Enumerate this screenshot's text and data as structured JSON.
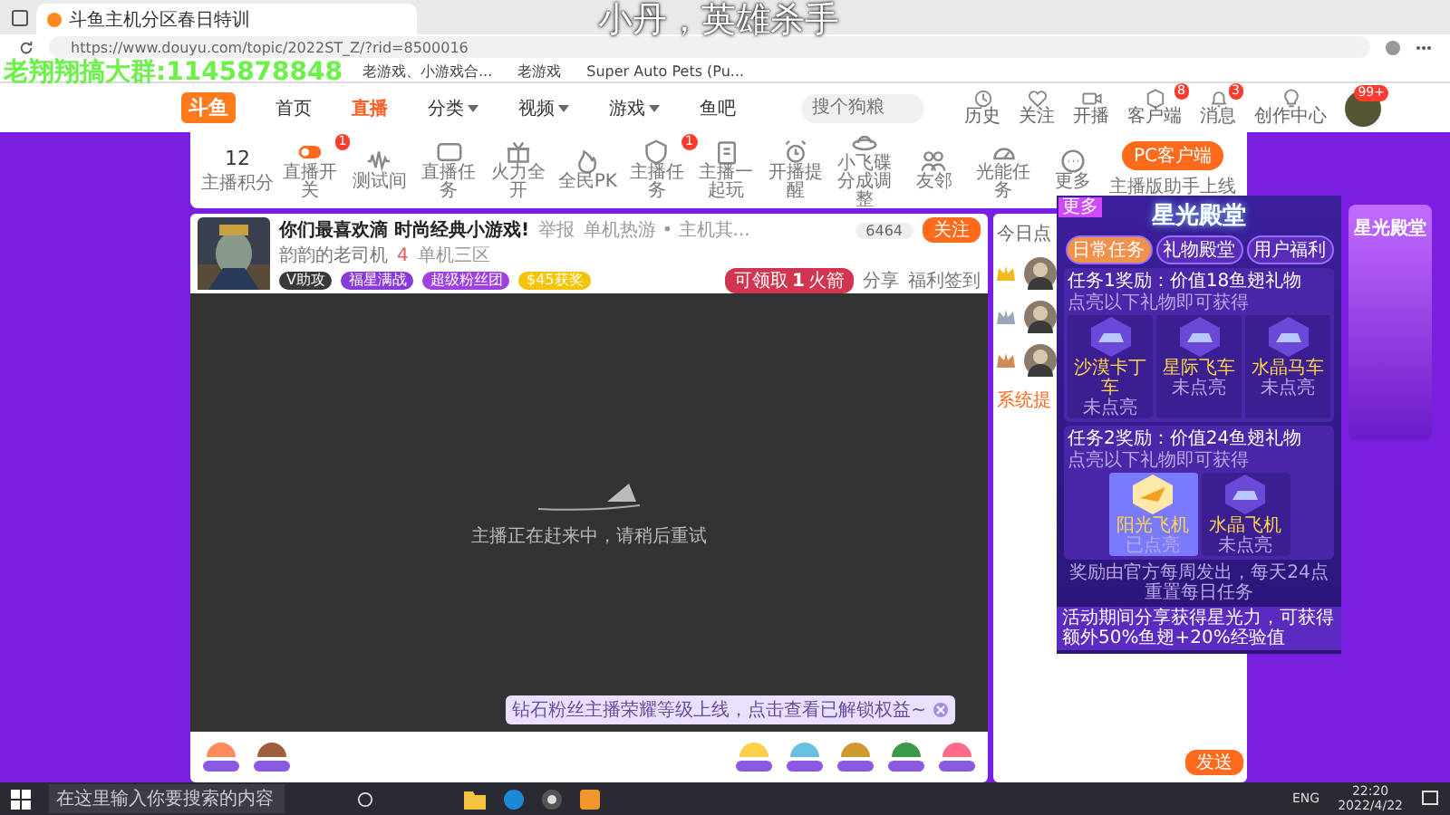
{
  "overlay_texts": [
    {
      "text": "小丹，英雄杀手",
      "kind": "title"
    },
    {
      "text": "老翔翔搞大群:1145878848",
      "kind": "group"
    }
  ],
  "browser": {
    "tab_title": "斗鱼主机分区春日特训",
    "url": "https://www.douyu.com/topic/2022ST_Z/?rid=8500016",
    "bookmarks": [
      "老游戏、小游戏合...",
      "老游戏",
      "Super Auto Pets (Pu..."
    ]
  },
  "site_header": {
    "logo": "斗鱼",
    "nav": [
      {
        "label": "首页",
        "selected": false,
        "dropdown": false
      },
      {
        "label": "直播",
        "selected": true,
        "dropdown": false
      },
      {
        "label": "分类",
        "selected": false,
        "dropdown": true
      },
      {
        "label": "视频",
        "selected": false,
        "dropdown": true
      },
      {
        "label": "游戏",
        "selected": false,
        "dropdown": true
      },
      {
        "label": "鱼吧",
        "selected": false,
        "dropdown": false
      }
    ],
    "search": {
      "placeholder": "搜个狗粮"
    },
    "actions": [
      {
        "label": "历史",
        "kind": "clock"
      },
      {
        "label": "关注",
        "kind": "heart"
      },
      {
        "label": "开播",
        "kind": "camera"
      },
      {
        "label": "客户端",
        "kind": "box",
        "badge": "8"
      },
      {
        "label": "消息",
        "kind": "bell",
        "badge": "3"
      },
      {
        "label": "创作中心",
        "kind": "bulb"
      }
    ],
    "avatar_badge": "99+"
  },
  "anchor_tools": {
    "score": "12",
    "score_label": "主播积分",
    "tools": [
      {
        "label": "直播开关",
        "kind": "toggle",
        "badge": "1"
      },
      {
        "label": "测试间",
        "kind": "wave"
      },
      {
        "label": "直播任务",
        "kind": "ad"
      },
      {
        "label": "火力全开",
        "kind": "gift"
      },
      {
        "label": "全民PK",
        "kind": "fire"
      },
      {
        "label": "主播任务",
        "kind": "shield",
        "badge": "1"
      },
      {
        "label": "主播一起玩",
        "kind": "clip"
      },
      {
        "label": "开播提醒",
        "kind": "alarm"
      },
      {
        "label": "小飞碟分成调整",
        "kind": "ufo"
      },
      {
        "label": "友邻",
        "kind": "people"
      },
      {
        "label": "光能任务",
        "kind": "gauge"
      },
      {
        "label": "更多",
        "kind": "more"
      }
    ],
    "client_button": "PC客户端",
    "client_note": "主播版助手上线"
  },
  "room": {
    "title": "你们最喜欢滴 时尚经典小游戏!",
    "report": "举报",
    "category": "单机热游 • 主机其...",
    "owner": "韵韵的老司机",
    "fans": "4",
    "location": "单机三区",
    "badges": [
      {
        "label": "V助攻",
        "color": "#3a3a3a"
      },
      {
        "label": "福星满战",
        "color": "#8a3ad8"
      },
      {
        "label": "超级粉丝团",
        "color": "#a040e0"
      },
      {
        "label": "$45获奖",
        "color": "#f5c400"
      }
    ],
    "hot": "6464",
    "follow": "关注",
    "claim": "可领取",
    "claim_count": "1",
    "claim_unit": "火箭",
    "share": "分享",
    "sign_in": "福利签到"
  },
  "video": {
    "message": "主播正在赶来中，请稍后重试",
    "notice": "钻石粉丝主播荣耀等级上线，点击查看已解锁权益~"
  },
  "chat": {
    "tab": "今日点",
    "ranks": [
      {
        "color": "#f2b81c"
      },
      {
        "color": "#9aa6b8"
      },
      {
        "color": "#d08a55"
      }
    ],
    "system_label": "系统提",
    "send": "发送"
  },
  "popup": {
    "corner": "更多",
    "title": "星光殿堂",
    "tabs": [
      {
        "label": "日常任务",
        "selected": true
      },
      {
        "label": "礼物殿堂",
        "selected": false
      },
      {
        "label": "用户福利",
        "selected": false
      }
    ],
    "tasks": [
      {
        "title": "任务1奖励：价值18鱼翅礼物",
        "hint": "点亮以下礼物即可获得",
        "gifts": [
          {
            "name": "沙漠卡丁车",
            "status": "未点亮",
            "lit": false
          },
          {
            "name": "星际飞车",
            "status": "未点亮",
            "lit": false
          },
          {
            "name": "水晶马车",
            "status": "未点亮",
            "lit": false
          }
        ]
      },
      {
        "title": "任务2奖励：价值24鱼翅礼物",
        "hint": "点亮以下礼物即可获得",
        "gifts": [
          {
            "name": "阳光飞机",
            "status": "已点亮",
            "lit": true
          },
          {
            "name": "水晶飞机",
            "status": "未点亮",
            "lit": false
          }
        ]
      }
    ],
    "footer": "奖励由官方每周发出，每天24点重置每日任务",
    "banner": "活动期间分享获得星光力，可获得额外50%鱼翅+20%经验值"
  },
  "side_banner": {
    "title": "星光殿堂"
  },
  "taskbar": {
    "search_placeholder": "在这里输入你要搜索的内容",
    "language": "ENG",
    "time": "22:20",
    "date": "2022/4/22"
  }
}
